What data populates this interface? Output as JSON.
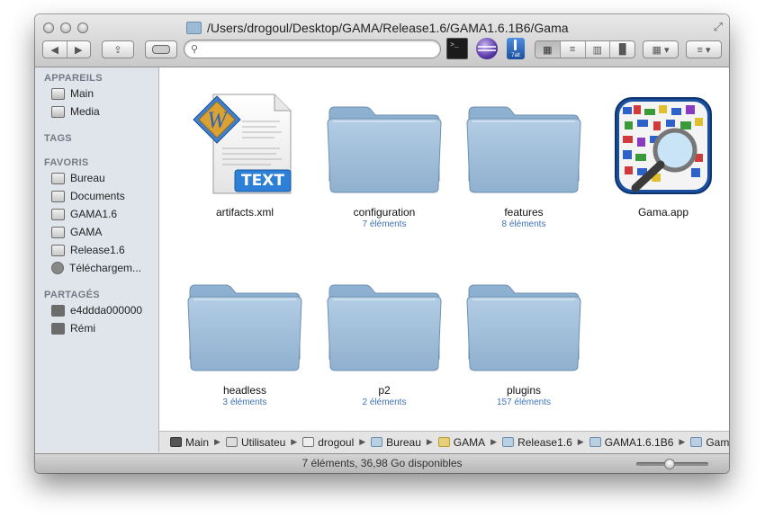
{
  "window": {
    "path_title": "/Users/drogoul/Desktop/GAMA/Release1.6/GAMA1.6.1B6/Gama"
  },
  "toolbar": {
    "back_label": "◀",
    "forward_label": "▶",
    "search_value": "",
    "terminal_icon": "terminal-icon",
    "eclipse_icon": "eclipse-icon",
    "app_label": "7alt",
    "view_modes": [
      "▦",
      "≡",
      "▥",
      "▐▌"
    ],
    "arrange_label": "▦ ▾",
    "action_label": "≡ ▾"
  },
  "sidebar": {
    "sections": {
      "devices": "APPAREILS",
      "tags": "TAGS",
      "favorites": "FAVORIS",
      "shared": "PARTAGÉS"
    },
    "devices": [
      {
        "label": "Main"
      },
      {
        "label": "Media"
      }
    ],
    "favorites": [
      {
        "label": "Bureau"
      },
      {
        "label": "Documents"
      },
      {
        "label": "GAMA1.6"
      },
      {
        "label": "GAMA"
      },
      {
        "label": "Release1.6"
      },
      {
        "label": "Téléchargem..."
      }
    ],
    "shared": [
      {
        "label": "e4ddda000000"
      },
      {
        "label": "Rémi"
      }
    ]
  },
  "files": [
    {
      "name": "artifacts.xml",
      "count": "",
      "kind": "text-file"
    },
    {
      "name": "configuration",
      "count": "7 éléments",
      "kind": "folder"
    },
    {
      "name": "features",
      "count": "8 éléments",
      "kind": "folder"
    },
    {
      "name": "Gama.app",
      "count": "",
      "kind": "application"
    },
    {
      "name": "headless",
      "count": "3 éléments",
      "kind": "folder"
    },
    {
      "name": "p2",
      "count": "2 éléments",
      "kind": "folder"
    },
    {
      "name": "plugins",
      "count": "157 éléments",
      "kind": "folder"
    }
  ],
  "text_badge": "TEXT",
  "breadcrumbs": [
    "Main",
    "Utilisateu",
    "drogoul",
    "Bureau",
    "GAMA",
    "Release1.6",
    "GAMA1.6.1B6",
    "Gama"
  ],
  "status": {
    "text": "7 éléments, 36,98 Go disponibles",
    "zoom_level": 0.45
  },
  "colors": {
    "folder_blue": "#9fc0dc",
    "count_blue": "#3f73b8",
    "sidebar_bg": "#e0e5ec"
  }
}
